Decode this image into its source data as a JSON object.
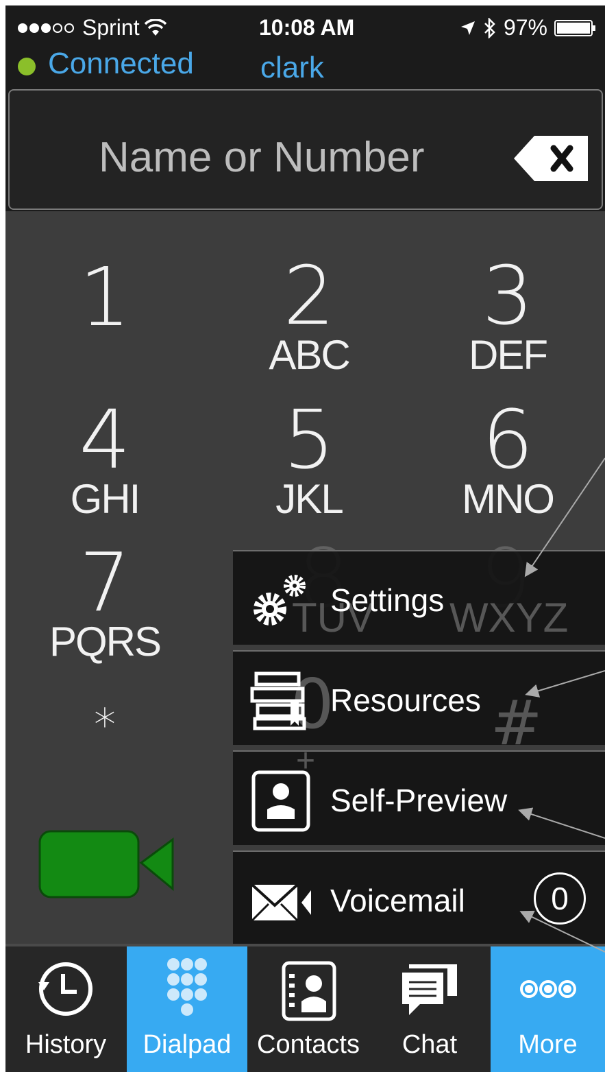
{
  "status_bar": {
    "carrier": "Sprint",
    "time": "10:08 AM",
    "battery": "97%"
  },
  "connection": {
    "status": "Connected",
    "user": "clark"
  },
  "search": {
    "placeholder": "Name or Number"
  },
  "dialpad": {
    "keys": [
      {
        "num": "1",
        "letters": ""
      },
      {
        "num": "2",
        "letters": "ABC"
      },
      {
        "num": "3",
        "letters": "DEF"
      },
      {
        "num": "4",
        "letters": "GHI"
      },
      {
        "num": "5",
        "letters": "JKL"
      },
      {
        "num": "6",
        "letters": "MNO"
      },
      {
        "num": "7",
        "letters": "PQRS"
      },
      {
        "num": "8",
        "letters": "TUV"
      },
      {
        "num": "9",
        "letters": "WXYZ"
      },
      {
        "num": "*",
        "letters": ""
      },
      {
        "num": "0",
        "letters": "+"
      },
      {
        "num": "#",
        "letters": ""
      }
    ]
  },
  "more_menu": {
    "items": [
      {
        "label": "Settings",
        "icon": "gears-icon"
      },
      {
        "label": "Resources",
        "icon": "books-icon"
      },
      {
        "label": "Self-Preview",
        "icon": "self-preview-icon"
      },
      {
        "label": "Voicemail",
        "icon": "envelope-icon",
        "badge": "0"
      }
    ]
  },
  "tabs": [
    {
      "label": "History",
      "icon": "history-icon",
      "active": false
    },
    {
      "label": "Dialpad",
      "icon": "dialpad-icon",
      "active": true
    },
    {
      "label": "Contacts",
      "icon": "contacts-icon",
      "active": false
    },
    {
      "label": "Chat",
      "icon": "chat-icon",
      "active": false
    },
    {
      "label": "More",
      "icon": "more-icon",
      "active": true
    }
  ],
  "colors": {
    "accent": "#37aaf2",
    "connected": "#8bbf2a",
    "video_button": "#138a13"
  }
}
